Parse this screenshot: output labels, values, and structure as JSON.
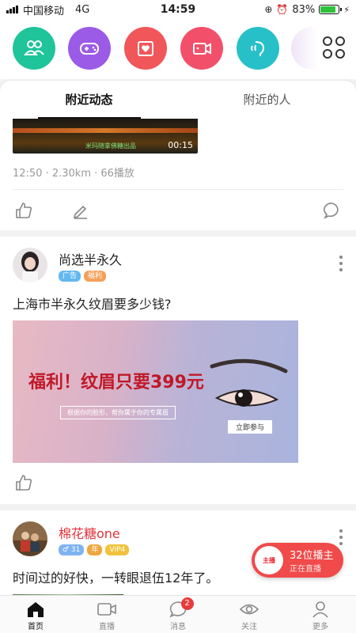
{
  "status_bar": {
    "carrier": "中国移动",
    "network": "4G",
    "time": "14:59",
    "battery": "83%",
    "battery_level": 0.83
  },
  "quick_icons": [
    {
      "name": "group-icon",
      "color": "#1fc49a"
    },
    {
      "name": "game-icon",
      "color": "#9c5be6"
    },
    {
      "name": "photo-heart-icon",
      "color": "#f0565a"
    },
    {
      "name": "video-camera-icon",
      "color": "#f2506a"
    },
    {
      "name": "voice-chat-icon",
      "color": "#28c0c8"
    }
  ],
  "tabs": [
    {
      "label": "附近动态",
      "active": true
    },
    {
      "label": "附近的人",
      "active": false
    }
  ],
  "post1": {
    "video_caption": "米玛随拿佛糖出品",
    "duration": "00:15",
    "meta": "12:50 · 2.30km · 66播放"
  },
  "post2": {
    "author": "尚选半永久",
    "badges": [
      {
        "label": "广告",
        "color": "#64b8f0"
      },
      {
        "label": "福利",
        "color": "#f4a05a"
      }
    ],
    "text": "上海市半永久纹眉要多少钱?",
    "ad_headline": "福利！纹眉只要399元",
    "ad_sub": "根据你的脸形，帮你属于你的专属眉",
    "ad_cta": "立即参与"
  },
  "post3": {
    "author": "棉花糖one",
    "badges": [
      {
        "label": "♂ 31",
        "color": "#7fb3f0"
      },
      {
        "label": "年",
        "color": "#f0a640"
      },
      {
        "label": "VIP4",
        "color": "#f2c23c"
      }
    ],
    "text": "时间过的好快，一转眼退伍12年了。"
  },
  "live": {
    "thumb_text": "主播",
    "count_text": "32位播主",
    "status_text": "正在直播"
  },
  "nav": [
    {
      "label": "首页",
      "active": true
    },
    {
      "label": "直播",
      "active": false
    },
    {
      "label": "消息",
      "active": false,
      "badge": "2"
    },
    {
      "label": "关注",
      "active": false
    },
    {
      "label": "更多",
      "active": false
    }
  ]
}
